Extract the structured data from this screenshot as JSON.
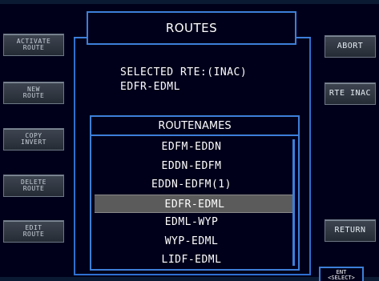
{
  "title": "ROUTES",
  "left_softkeys": [
    {
      "label": "ACTIVATE\nROUTE"
    },
    {
      "label": "NEW\nROUTE"
    },
    {
      "label": "COPY\nINVERT"
    },
    {
      "label": "DELETE\nROUTE"
    },
    {
      "label": "EDIT\nROUTE"
    }
  ],
  "right_softkeys": {
    "abort": "ABORT",
    "rte_inac": "RTE  INAC",
    "return": "RETURN"
  },
  "selected_route": {
    "label": "SELECTED RTE:(INAC)",
    "value": "EDFR-EDML"
  },
  "route_list": {
    "header": "ROUTENAMES",
    "items": [
      "EDFM-EDDN",
      "EDDN-EDFM",
      "EDDN-EDFM(1)",
      "EDFR-EDML",
      "EDML-WYP",
      "WYP-EDML",
      "LIDF-EDML"
    ],
    "selected_index": 3
  },
  "ent_key": {
    "label": "ENT\n<SELECT>"
  },
  "colors": {
    "frame": "#3d7fd9",
    "background": "#00001a",
    "selected_row": "#5b5b5b"
  }
}
